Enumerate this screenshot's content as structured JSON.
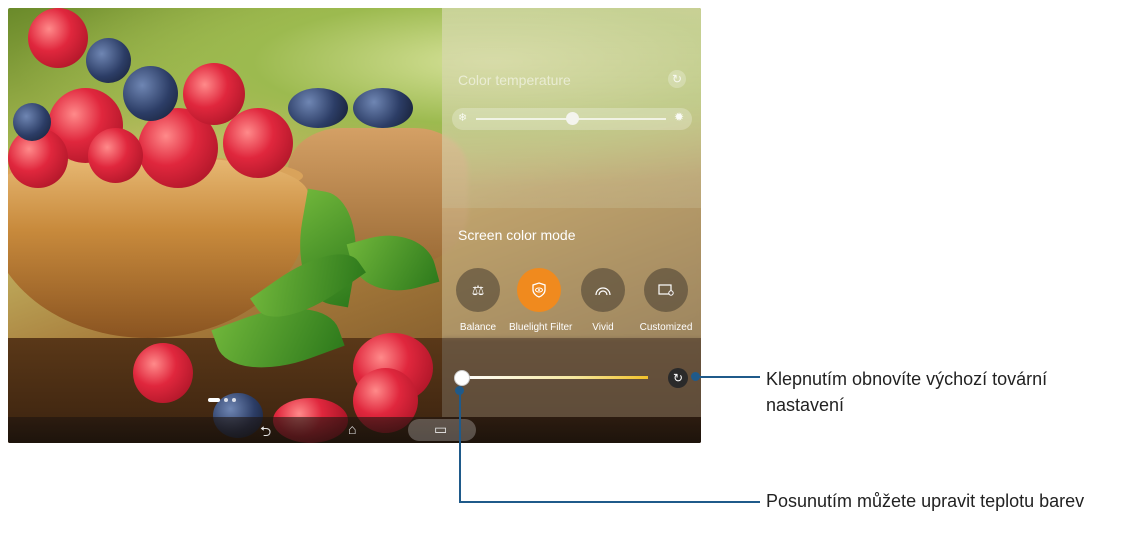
{
  "panel": {
    "color_temperature": {
      "title": "Color temperature",
      "reset_icon": "refresh-icon",
      "cold_icon": "snowflake-icon",
      "warm_icon": "sun-icon",
      "level": 0.5
    },
    "screen_color_mode": {
      "title": "Screen color mode",
      "modes": [
        {
          "label": "Balance",
          "icon": "scale-icon",
          "active": false
        },
        {
          "label": "Bluelight Filter",
          "icon": "eye-shield-icon",
          "active": true
        },
        {
          "label": "Vivid",
          "icon": "rainbow-icon",
          "active": false
        },
        {
          "label": "Customized",
          "icon": "monitor-settings-icon",
          "active": false
        }
      ],
      "active_color": "#f08a1e"
    },
    "filter_slider": {
      "level": 0.0,
      "reset_icon": "refresh-icon"
    }
  },
  "navbar": {
    "back_icon": "back-icon",
    "home_icon": "home-icon",
    "recent_icon": "recent-apps-icon"
  },
  "callouts": {
    "reset": "Klepnutím obnovíte výchozí tovární nastavení",
    "slider": "Posunutím můžete upravit teplotu barev",
    "line_color": "#1f5a8a"
  }
}
